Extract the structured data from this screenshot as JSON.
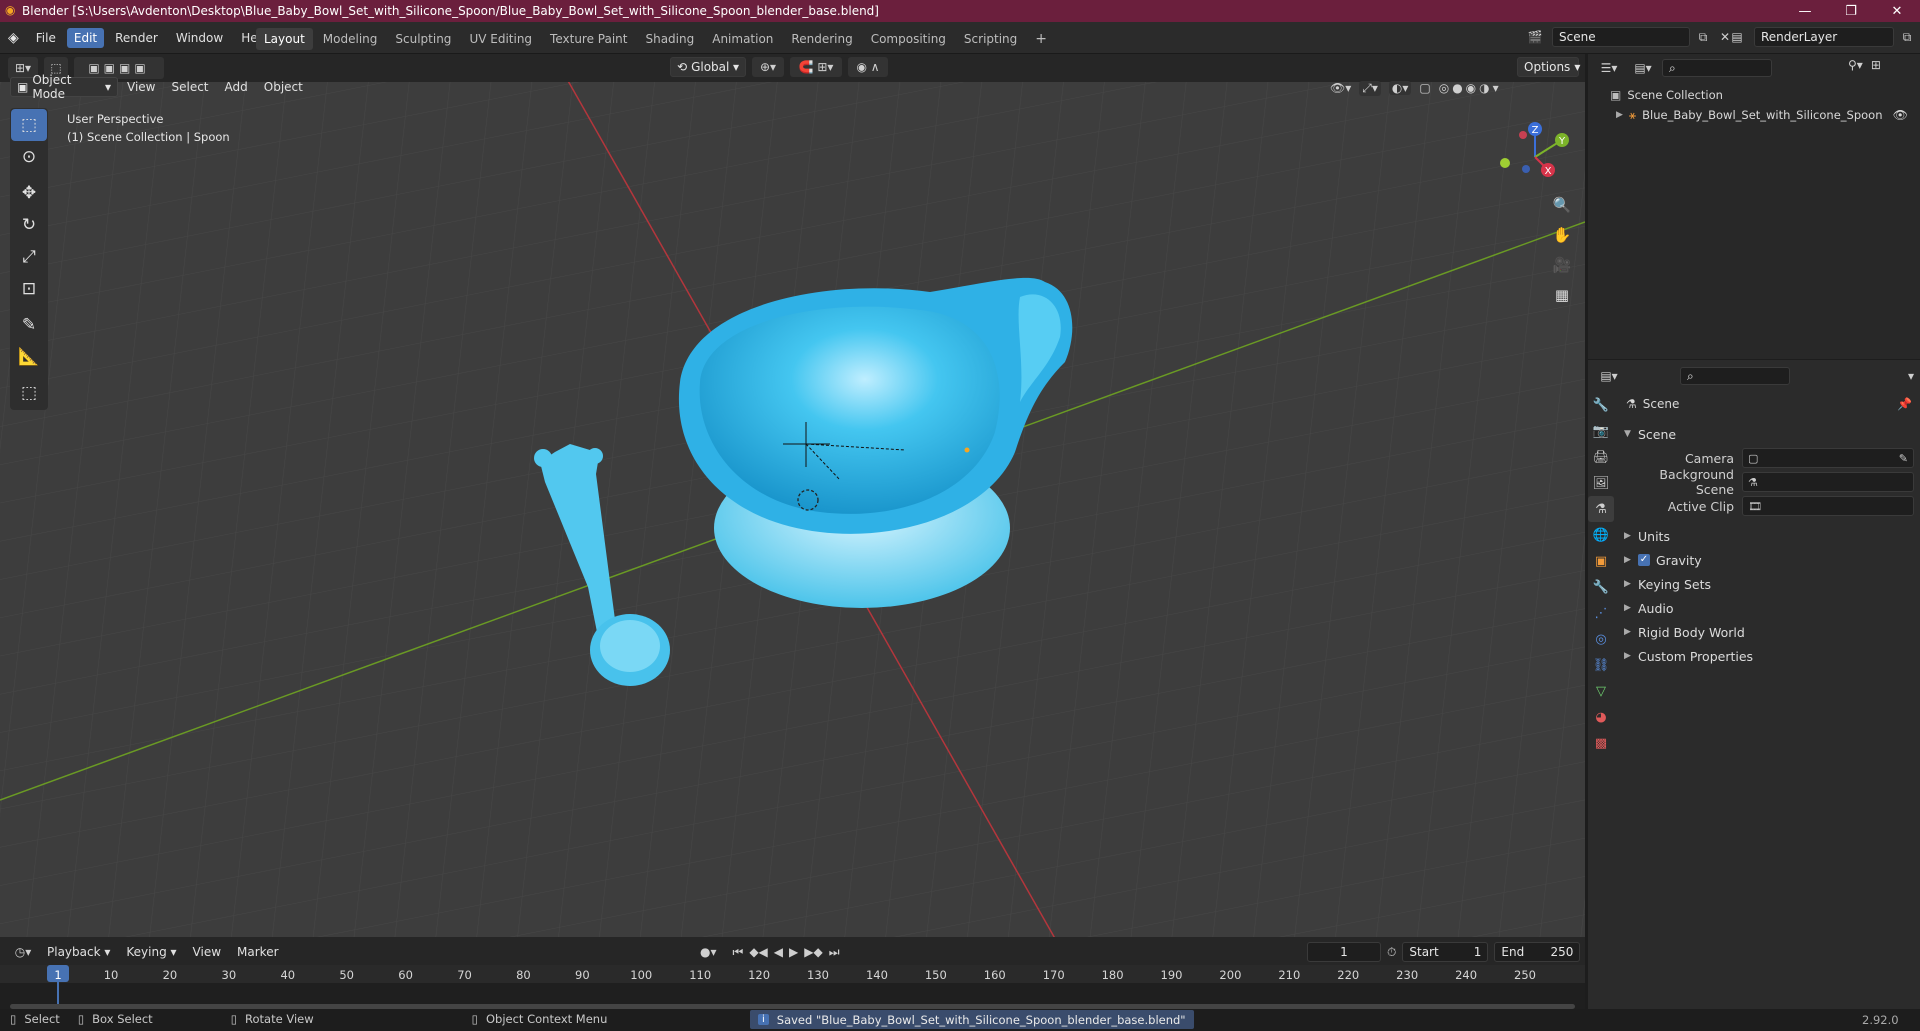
{
  "window": {
    "title": "Blender [S:\\Users\\Avdenton\\Desktop\\Blue_Baby_Bowl_Set_with_Silicone_Spoon/Blue_Baby_Bowl_Set_with_Silicone_Spoon_blender_base.blend]"
  },
  "menus": [
    "File",
    "Edit",
    "Render",
    "Window",
    "Help"
  ],
  "workspaces": [
    "Layout",
    "Modeling",
    "Sculpting",
    "UV Editing",
    "Texture Paint",
    "Shading",
    "Animation",
    "Rendering",
    "Compositing",
    "Scripting"
  ],
  "scene_field": "Scene",
  "renderlayer_field": "RenderLayer",
  "viewport": {
    "mode": "Object Mode",
    "menus": [
      "View",
      "Select",
      "Add",
      "Object"
    ],
    "orientation": "Global",
    "options": "Options",
    "info_line1": "User Perspective",
    "info_line2": "(1) Scene Collection | Spoon",
    "gizmo": {
      "x": "X",
      "y": "Y",
      "z": "Z"
    }
  },
  "outliner": {
    "root": "Scene Collection",
    "item": "Blue_Baby_Bowl_Set_with_Silicone_Spoon"
  },
  "properties": {
    "header": "Scene",
    "section": "Scene",
    "fields": [
      {
        "label": "Camera"
      },
      {
        "label": "Background Scene"
      },
      {
        "label": "Active Clip"
      }
    ],
    "panels": [
      "Units",
      "Gravity",
      "Keying Sets",
      "Audio",
      "Rigid Body World",
      "Custom Properties"
    ],
    "gravity_checked": true
  },
  "timeline": {
    "menus": [
      "Playback",
      "Keying",
      "View",
      "Marker"
    ],
    "current_frame": "1",
    "start_label": "Start",
    "start": "1",
    "end_label": "End",
    "end": "250",
    "ticks": [
      "1",
      "10",
      "20",
      "30",
      "40",
      "50",
      "60",
      "70",
      "80",
      "90",
      "100",
      "110",
      "120",
      "130",
      "140",
      "150",
      "160",
      "170",
      "180",
      "190",
      "200",
      "210",
      "220",
      "230",
      "240",
      "250"
    ]
  },
  "statusbar": {
    "select": "Select",
    "box_select": "Box Select",
    "rotate": "Rotate View",
    "context_menu": "Object Context Menu",
    "message": "Saved \"Blue_Baby_Bowl_Set_with_Silicone_Spoon_blender_base.blend\"",
    "version": "2.92.0"
  },
  "colors": {
    "accent": "#4772b3",
    "titlebar": "#6b1f3d",
    "object": "#3fc1ee"
  }
}
